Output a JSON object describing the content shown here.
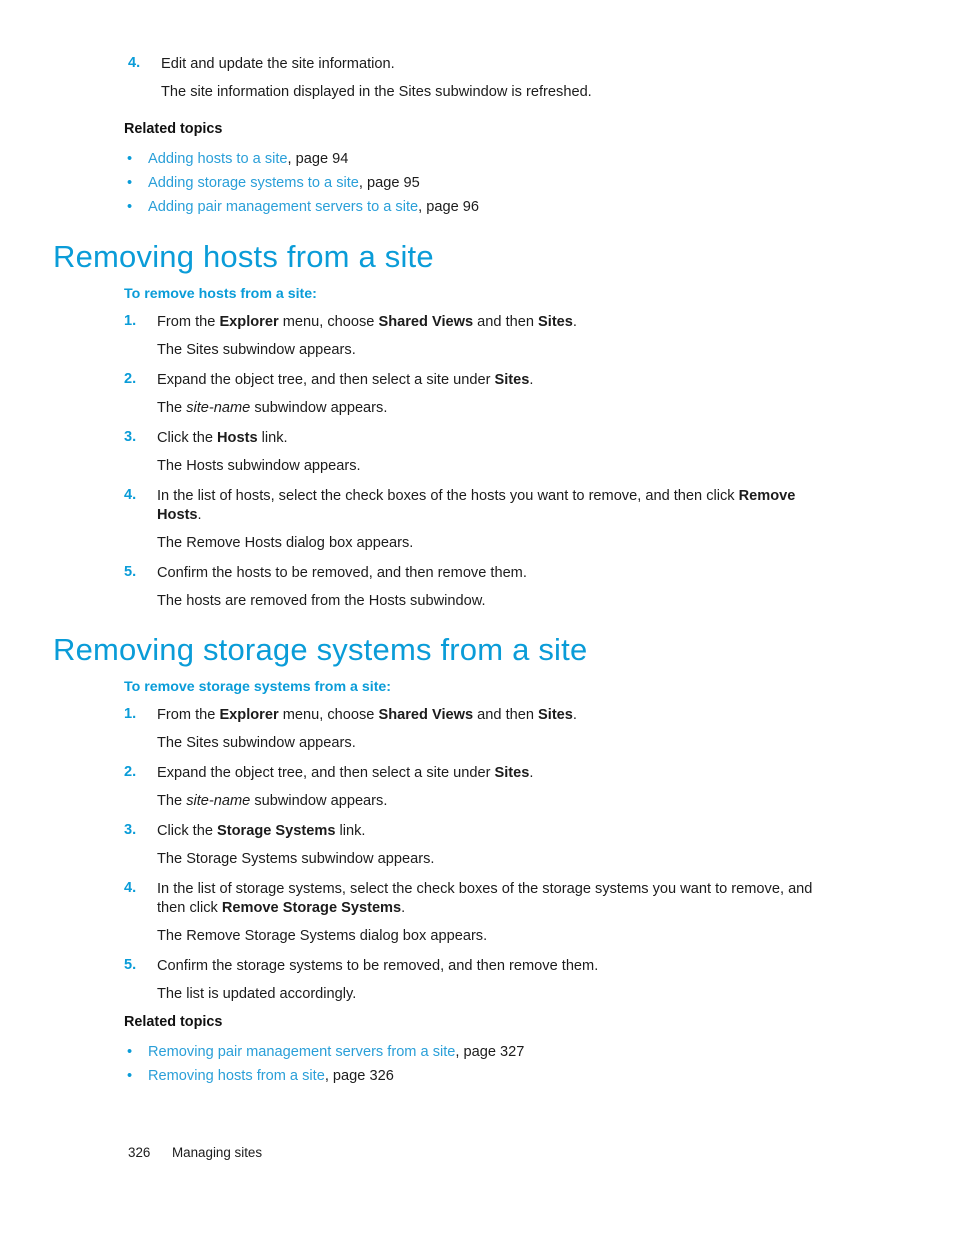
{
  "page": {
    "footer_page_number": "326",
    "footer_chapter": "Managing sites"
  },
  "top_step": {
    "number": "4.",
    "text": "Edit and update the site information.",
    "result": "The site information displayed in the Sites subwindow is refreshed."
  },
  "related_topics_top": {
    "heading": "Related topics",
    "items": [
      {
        "bullet": "•",
        "link": "Adding hosts to a site",
        "suffix": ", page 94"
      },
      {
        "bullet": "•",
        "link": "Adding storage systems to a site",
        "suffix": ", page 95"
      },
      {
        "bullet": "•",
        "link": "Adding pair management servers to a site",
        "suffix": ", page 96"
      }
    ]
  },
  "section_hosts": {
    "title": "Removing hosts from a site",
    "subtitle": "To remove hosts from a site:",
    "steps": [
      {
        "number": "1.",
        "pre": "From the ",
        "b1": "Explorer",
        "mid": " menu, choose ",
        "b2": "Shared Views",
        "mid2": " and then ",
        "b3": "Sites",
        "post": ".",
        "result": "The Sites subwindow appears."
      },
      {
        "number": "2.",
        "pre": "Expand the object tree, and then select a site under ",
        "b1": "Sites",
        "post": ".",
        "result_pre": "The ",
        "result_em": "site-name",
        "result_post": " subwindow appears."
      },
      {
        "number": "3.",
        "pre": "Click the ",
        "b1": "Hosts",
        "post": " link.",
        "result": "The Hosts subwindow appears."
      },
      {
        "number": "4.",
        "pre": "In the list of hosts, select the check boxes of the hosts you want to remove, and then click ",
        "b1": "Remove Hosts",
        "post": ".",
        "result": "The Remove Hosts dialog box appears."
      },
      {
        "number": "5.",
        "pre": "Confirm the hosts to be removed, and then remove them.",
        "result": "The hosts are removed from the Hosts subwindow."
      }
    ]
  },
  "section_storage": {
    "title": "Removing storage systems from a site",
    "subtitle": "To remove storage systems from a site:",
    "steps": [
      {
        "number": "1.",
        "pre": "From the ",
        "b1": "Explorer",
        "mid": " menu, choose ",
        "b2": "Shared Views",
        "mid2": " and then ",
        "b3": "Sites",
        "post": ".",
        "result": "The Sites subwindow appears."
      },
      {
        "number": "2.",
        "pre": "Expand the object tree, and then select a site under ",
        "b1": "Sites",
        "post": ".",
        "result_pre": "The ",
        "result_em": "site-name",
        "result_post": " subwindow appears."
      },
      {
        "number": "3.",
        "pre": "Click the ",
        "b1": "Storage Systems",
        "post": " link.",
        "result": "The Storage Systems subwindow appears."
      },
      {
        "number": "4.",
        "pre": "In the list of storage systems, select the check boxes of the storage systems you want to remove, and then click ",
        "b1": "Remove Storage Systems",
        "post": ".",
        "result": "The Remove Storage Systems dialog box appears."
      },
      {
        "number": "5.",
        "pre": "Confirm the storage systems to be removed, and then remove them.",
        "result": "The list is updated accordingly."
      }
    ]
  },
  "related_topics_bottom": {
    "heading": "Related topics",
    "items": [
      {
        "bullet": "•",
        "link": "Removing pair management servers from a site",
        "suffix": ", page 327"
      },
      {
        "bullet": "•",
        "link": "Removing hosts from a site",
        "suffix": ", page 326"
      }
    ]
  },
  "colors": {
    "accent_blue": "#0a9cd8",
    "link_blue": "#2a9fd8",
    "body_text": "#1c1c1c"
  }
}
